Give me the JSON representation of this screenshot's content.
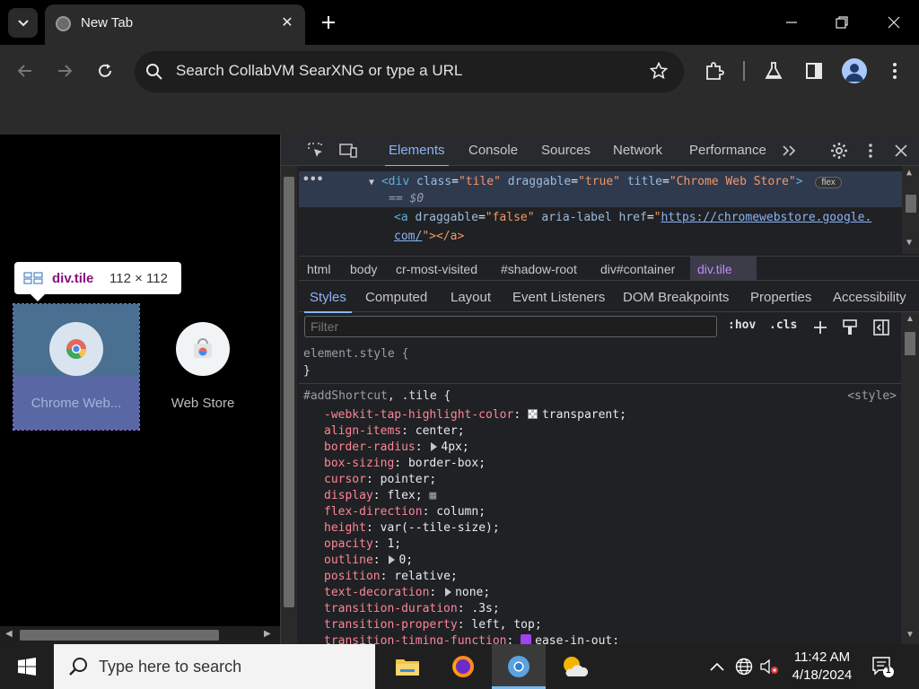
{
  "browser": {
    "tab_title": "New Tab",
    "omnibox_placeholder": "Search CollabVM SearXNG or type a URL"
  },
  "page": {
    "tooltip": {
      "selector": "div.tile",
      "dimensions": "112 × 112"
    },
    "tiles": [
      {
        "label": "Chrome Web..."
      },
      {
        "label": "Web Store"
      }
    ]
  },
  "devtools": {
    "tabs": [
      "Elements",
      "Console",
      "Sources",
      "Network",
      "Performance"
    ],
    "active_tab": "Elements",
    "dom": {
      "line1_tag": "<div",
      "line1_attr_class": "class",
      "line1_val_class": "\"tile\"",
      "line1_attr_drag": "draggable",
      "line1_val_drag": "\"true\"",
      "line1_attr_title": "title",
      "line1_val_title": "\"Chrome Web Store\"",
      "line1_close": ">",
      "flex_badge": "flex",
      "eq0": "== $0",
      "line2_tag": "<a",
      "line2_attr_drag": "draggable",
      "line2_val_drag": "\"false\"",
      "line2_attr_aria": "aria-label",
      "line2_attr_href": "href",
      "line2_url_a": "https://chromewebstore.google.",
      "line2_url_b": "com/",
      "line2_close": "\"></a>"
    },
    "breadcrumbs": [
      "html",
      "body",
      "cr-most-visited",
      "#shadow-root",
      "div#container",
      "div.tile"
    ],
    "subtabs": [
      "Styles",
      "Computed",
      "Layout",
      "Event Listeners",
      "DOM Breakpoints",
      "Properties",
      "Accessibility"
    ],
    "filter_placeholder": "Filter",
    "hov": ":hov",
    "cls": ".cls",
    "styles": {
      "element_style": "element.style {",
      "close_brace": "}",
      "rule_selector_a": "#addShortcut",
      "rule_selector_b": ".tile {",
      "rule_origin": "<style>",
      "props": [
        {
          "name": "-webkit-tap-highlight-color",
          "value": "transparent;"
        },
        {
          "name": "align-items",
          "value": "center;"
        },
        {
          "name": "border-radius",
          "value": "4px;"
        },
        {
          "name": "box-sizing",
          "value": "border-box;"
        },
        {
          "name": "cursor",
          "value": "pointer;"
        },
        {
          "name": "display",
          "value": "flex;"
        },
        {
          "name": "flex-direction",
          "value": "column;"
        },
        {
          "name": "height",
          "value": "var(--tile-size);"
        },
        {
          "name": "opacity",
          "value": "1;"
        },
        {
          "name": "outline",
          "value": "0;"
        },
        {
          "name": "position",
          "value": "relative;"
        },
        {
          "name": "text-decoration",
          "value": "none;"
        },
        {
          "name": "transition-duration",
          "value": ".3s;"
        },
        {
          "name": "transition-property",
          "value": "left, top;"
        },
        {
          "name": "transition-timing-function",
          "value": "ease-in-out;"
        }
      ]
    }
  },
  "taskbar": {
    "search_placeholder": "Type here to search",
    "time": "11:42 AM",
    "date": "4/18/2024",
    "notification_count": "1"
  },
  "colors": {
    "devtools_accent": "#8ab4f8",
    "taskbar_active_indicator": "#76b9ed"
  }
}
